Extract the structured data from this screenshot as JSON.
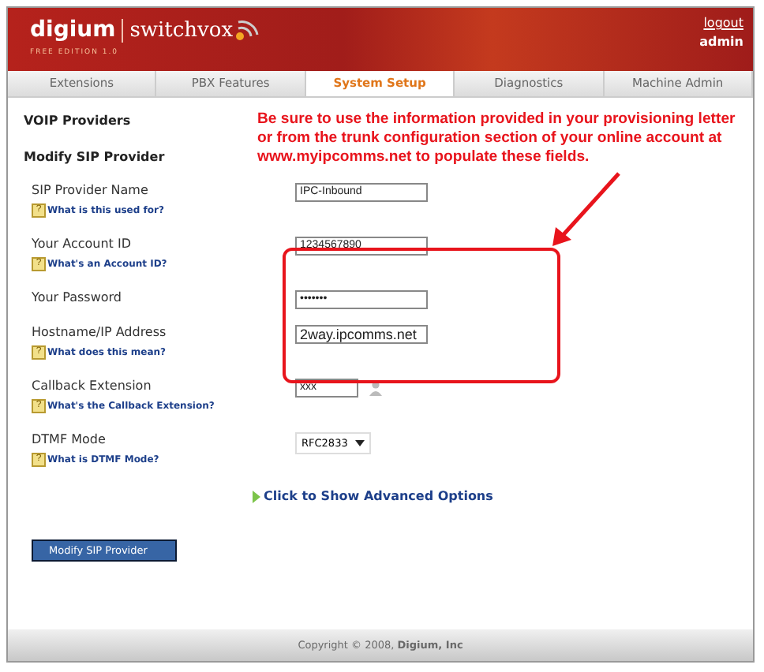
{
  "header": {
    "logo_left": "digium",
    "logo_right": "switchvox",
    "edition": "FREE EDITION 1.0",
    "logout": "logout",
    "user": "admin"
  },
  "tabs": [
    {
      "label": "Extensions",
      "selected": false
    },
    {
      "label": "PBX Features",
      "selected": false
    },
    {
      "label": "System Setup",
      "selected": true
    },
    {
      "label": "Diagnostics",
      "selected": false
    },
    {
      "label": "Machine Admin",
      "selected": false
    }
  ],
  "section_title": "VOIP Providers",
  "page_title": "Modify SIP Provider",
  "annotation": "Be sure to use the information provided in your provisioning letter or from the trunk configuration section of your online account at www.myipcomms.net to populate these fields.",
  "fields": [
    {
      "kind": "text",
      "label": "SIP Provider Name",
      "value": "IPC-Inbound",
      "help_mark": "?",
      "help": "What is this used for?"
    },
    {
      "kind": "text",
      "label": "Your Account ID",
      "value": "1234567890",
      "help_mark": "?",
      "help": "What's an Account ID?"
    },
    {
      "kind": "password",
      "label": "Your Password",
      "value": "•••••••"
    },
    {
      "kind": "text",
      "label": "Hostname/IP Address",
      "value": "2way.ipcomms.net",
      "help_mark": "?",
      "help": "What does this mean?",
      "large": true
    },
    {
      "kind": "extension",
      "label": "Callback Extension",
      "value": "xxx",
      "help_mark": "?",
      "help": "What's the Callback Extension?"
    },
    {
      "kind": "select",
      "label": "DTMF Mode",
      "value": "RFC2833",
      "help_mark": "?",
      "help": "What is DTMF Mode?"
    }
  ],
  "advanced_link": "Click to Show Advanced Options",
  "submit_button": "Modify SIP Provider",
  "footer": {
    "prefix": "Copyright © 2008, ",
    "company": "Digium, Inc"
  }
}
